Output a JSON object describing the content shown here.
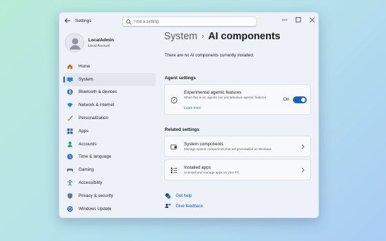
{
  "window": {
    "title": "Settings"
  },
  "search": {
    "placeholder": "Find a setting"
  },
  "profile": {
    "name": "LocalAdmin",
    "account_type": "Local Account"
  },
  "sidebar": {
    "items": [
      {
        "label": "Home",
        "icon": "home-icon",
        "color": "#c9651e"
      },
      {
        "label": "System",
        "icon": "system-icon",
        "color": "#2f7fd6",
        "active": true
      },
      {
        "label": "Bluetooth & devices",
        "icon": "bluetooth-icon",
        "color": "#1d6fd1"
      },
      {
        "label": "Network & internet",
        "icon": "wifi-icon",
        "color": "#2a7bd8"
      },
      {
        "label": "Personalization",
        "icon": "brush-icon",
        "color": "#d8892a"
      },
      {
        "label": "Apps",
        "icon": "apps-icon",
        "color": "#46607c"
      },
      {
        "label": "Accounts",
        "icon": "accounts-icon",
        "color": "#1f9c78"
      },
      {
        "label": "Time & language",
        "icon": "globe-clock-icon",
        "color": "#2a79c9"
      },
      {
        "label": "Gaming",
        "icon": "gamepad-icon",
        "color": "#6f7a86"
      },
      {
        "label": "Accessibility",
        "icon": "accessibility-icon",
        "color": "#1f6cc6"
      },
      {
        "label": "Privacy & security",
        "icon": "shield-icon",
        "color": "#6c7885"
      },
      {
        "label": "Windows Update",
        "icon": "update-icon",
        "color": "#1f6cc6"
      }
    ]
  },
  "breadcrumb": {
    "parent": "System",
    "separator": "›",
    "current": "AI components"
  },
  "main": {
    "empty_message": "There are no AI components currently installed.",
    "agent_settings": {
      "heading": "Agent settings",
      "experimental": {
        "title": "Experimental agentic features",
        "description": "When this is on, agents can use Windows agentic features",
        "link": "Learn more",
        "toggle_state": "On",
        "toggle_on": true
      }
    },
    "related_settings": {
      "heading": "Related settings",
      "items": [
        {
          "title": "System components",
          "description": "Manage system components that are preinstalled on Windows"
        },
        {
          "title": "Installed apps",
          "description": "Uninstall and manage apps on your PC"
        }
      ]
    },
    "footer_links": [
      {
        "label": "Get help"
      },
      {
        "label": "Give feedback"
      }
    ]
  },
  "colors": {
    "accent": "#1065b8",
    "link": "#0b57c4"
  }
}
